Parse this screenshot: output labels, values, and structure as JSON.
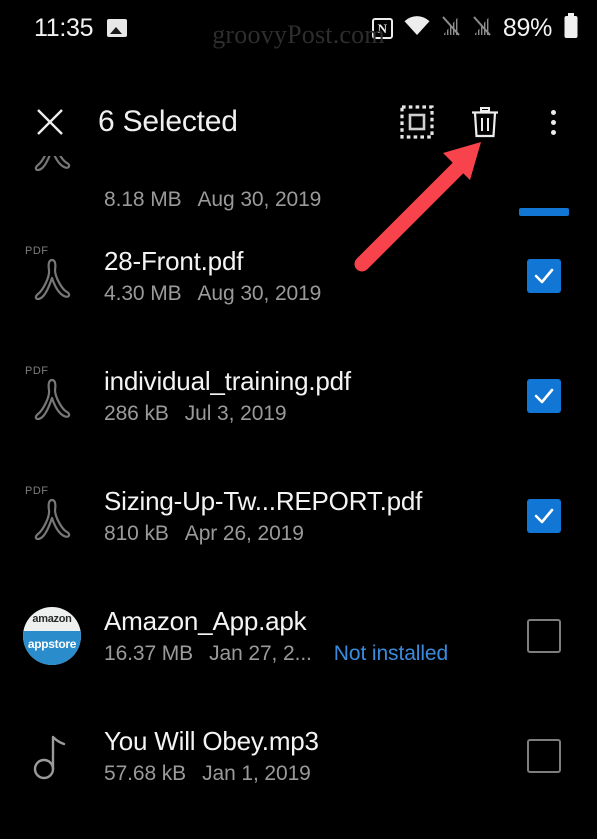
{
  "status_bar": {
    "time": "11:35",
    "photo_icon": "photo-icon",
    "nfc_icon": "N",
    "wifi_icon": "wifi-icon",
    "signal_icon_1": "signal-off-icon",
    "signal_icon_2": "signal-off-icon",
    "battery_percent": "89%",
    "battery_icon": "battery-icon"
  },
  "watermark": {
    "text": "groovyPost.com"
  },
  "action_bar": {
    "close_icon": "close-icon",
    "title": "6 Selected",
    "select_all_icon": "select-all-icon",
    "delete_icon": "trash-icon",
    "overflow_icon": "more-vertical-icon"
  },
  "annotation": {
    "arrow_color": "#f9434c",
    "points_to": "trash-icon"
  },
  "colors": {
    "background": "#000000",
    "checkbox_checked": "#1277d4",
    "checkbox_border": "#7d7d7d",
    "primary_text": "#f4f4f4",
    "secondary_text": "#9a9a9a",
    "link_text": "#3a8bdd"
  },
  "files": [
    {
      "name": "",
      "size": "8.18 MB",
      "date": "Aug 30, 2019",
      "status": "",
      "icon": "pdf-icon",
      "checked": true,
      "partial": true
    },
    {
      "name": "28-Front.pdf",
      "size": "4.30 MB",
      "date": "Aug 30, 2019",
      "status": "",
      "icon": "pdf-icon",
      "checked": true,
      "partial": false
    },
    {
      "name": "individual_training.pdf",
      "size": "286 kB",
      "date": "Jul 3, 2019",
      "status": "",
      "icon": "pdf-icon",
      "checked": true,
      "partial": false
    },
    {
      "name": "Sizing-Up-Tw...REPORT.pdf",
      "size": "810 kB",
      "date": "Apr 26, 2019",
      "status": "",
      "icon": "pdf-icon",
      "checked": true,
      "partial": false
    },
    {
      "name": "Amazon_App.apk",
      "size": "16.37 MB",
      "date": "Jan 27, 2...",
      "status": "Not installed",
      "icon": "amazon-appstore-icon",
      "checked": false,
      "partial": false
    },
    {
      "name": "You Will Obey.mp3",
      "size": "57.68 kB",
      "date": "Jan 1, 2019",
      "status": "",
      "icon": "music-note-icon",
      "checked": false,
      "partial": false
    }
  ],
  "amazon_icon_text": {
    "top": "amazon",
    "bottom": "appstore"
  },
  "pdf_icon_label": "PDF"
}
